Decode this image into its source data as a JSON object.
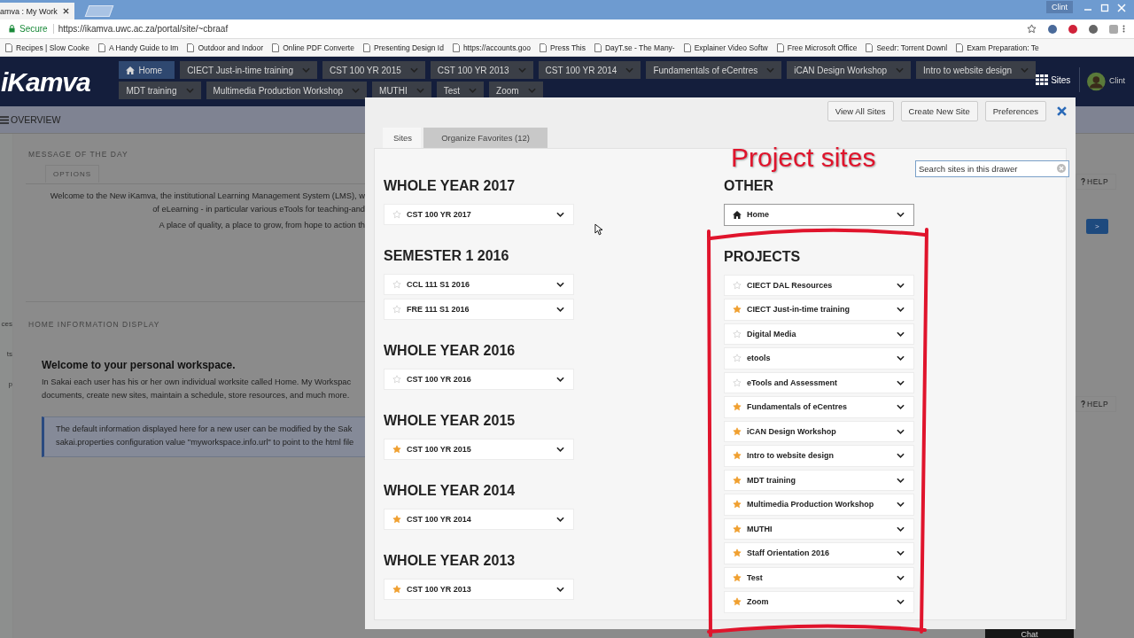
{
  "browser": {
    "tab_title": "amva : My Work",
    "user": "Clint",
    "secure_label": "Secure",
    "url": "https://ikamva.uwc.ac.za/portal/site/~cbraaf",
    "bookmarks": [
      "Recipes | Slow Cooke",
      "A Handy Guide to Im",
      "Outdoor and Indoor",
      "Online PDF Converte",
      "Presenting Design Id",
      "https://accounts.goo",
      "Press This",
      "DayT.se - The Many-",
      "Explainer Video Softw",
      "Free Microsoft Office",
      "Seedr: Torrent Downl",
      "Exam Preparation: Te"
    ]
  },
  "header": {
    "logo": "iKamva",
    "rows": [
      [
        {
          "label": "Home",
          "kind": "home",
          "selected": true
        },
        {
          "label": "CIECT Just-in-time training",
          "kind": "site",
          "selected": false
        },
        {
          "label": "CST 100 YR 2015",
          "kind": "site",
          "selected": false
        },
        {
          "label": "CST 100 YR 2013",
          "kind": "site",
          "selected": false
        },
        {
          "label": "CST 100 YR 2014",
          "kind": "site",
          "selected": false
        },
        {
          "label": "Fundamentals of eCentres",
          "kind": "site",
          "selected": false
        },
        {
          "label": "iCAN Design Workshop",
          "kind": "site",
          "selected": false
        },
        {
          "label": "Intro to website design",
          "kind": "site",
          "selected": false
        }
      ],
      [
        {
          "label": "MDT training",
          "kind": "site",
          "selected": false
        },
        {
          "label": "Multimedia Production Workshop",
          "kind": "site",
          "selected": false
        },
        {
          "label": "MUTHI",
          "kind": "site",
          "selected": false
        },
        {
          "label": "Test",
          "kind": "site",
          "selected": false
        },
        {
          "label": "Zoom",
          "kind": "site",
          "selected": false
        }
      ]
    ],
    "sites_button": "Sites",
    "user": "Clint"
  },
  "page": {
    "overview": "OVERVIEW",
    "side_items": [
      "ces",
      "ts",
      "p"
    ],
    "motd": {
      "title": "MESSAGE OF THE DAY",
      "options": "OPTIONS",
      "lines": [
        "Welcome to the New iKamva, the institutional Learning Management System (LMS), w",
        "of eLearning - in particular various eTools for teaching-and"
      ],
      "tagline": "A place of quality, a place to grow, from hope to action th"
    },
    "home_info": {
      "title": "HOME INFORMATION DISPLAY",
      "heading": "Welcome to your personal workspace.",
      "lines": [
        "In Sakai each user has his or her own individual worksite called Home. My Workspac",
        "documents, create new sites, maintain a schedule, store resources, and much more."
      ],
      "note_lines": [
        "The default information displayed here for a new user can be modified by the Sak",
        "sakai.properties configuration value \"myworkspace.info.url\" to point to the html file"
      ]
    },
    "help_buttons": [
      "HELP",
      "HELP"
    ],
    "go_button": ">"
  },
  "drawer": {
    "actions": [
      "View All Sites",
      "Create New Site",
      "Preferences"
    ],
    "tabs": [
      {
        "label": "Sites",
        "selected": true
      },
      {
        "label": "Organize Favorites (12)",
        "selected": false
      }
    ],
    "search": {
      "placeholder": "Search sites in this drawer"
    },
    "left_groups": [
      {
        "title": "WHOLE YEAR 2017",
        "sites": [
          {
            "name": "CST 100 YR 2017",
            "favorite": false
          }
        ]
      },
      {
        "title": "SEMESTER 1 2016",
        "sites": [
          {
            "name": "CCL 111 S1 2016",
            "favorite": false
          },
          {
            "name": "FRE 111 S1 2016",
            "favorite": false
          }
        ]
      },
      {
        "title": "WHOLE YEAR 2016",
        "sites": [
          {
            "name": "CST 100 YR 2016",
            "favorite": false
          }
        ]
      },
      {
        "title": "WHOLE YEAR 2015",
        "sites": [
          {
            "name": "CST 100 YR 2015",
            "favorite": true
          }
        ]
      },
      {
        "title": "WHOLE YEAR 2014",
        "sites": [
          {
            "name": "CST 100 YR 2014",
            "favorite": true
          }
        ]
      },
      {
        "title": "WHOLE YEAR 2013",
        "sites": [
          {
            "name": "CST 100 YR 2013",
            "favorite": true
          }
        ]
      }
    ],
    "right_groups": [
      {
        "title": "OTHER",
        "sites": [
          {
            "name": "Home",
            "kind": "home"
          }
        ]
      },
      {
        "title": "PROJECTS",
        "sites": [
          {
            "name": "CIECT DAL Resources",
            "favorite": false
          },
          {
            "name": "CIECT Just-in-time training",
            "favorite": true
          },
          {
            "name": "Digital Media",
            "favorite": false
          },
          {
            "name": "etools",
            "favorite": false
          },
          {
            "name": "eTools and Assessment",
            "favorite": false
          },
          {
            "name": "Fundamentals of eCentres",
            "favorite": true
          },
          {
            "name": "iCAN Design Workshop",
            "favorite": true
          },
          {
            "name": "Intro to website design",
            "favorite": true
          },
          {
            "name": "MDT training",
            "favorite": true
          },
          {
            "name": "Multimedia Production Workshop",
            "favorite": true
          },
          {
            "name": "MUTHI",
            "favorite": true
          },
          {
            "name": "Staff Orientation 2016",
            "favorite": true
          },
          {
            "name": "Test",
            "favorite": true
          },
          {
            "name": "Zoom",
            "favorite": true
          }
        ]
      }
    ]
  },
  "annotation": {
    "label": "Project sites"
  },
  "chat": "Chat"
}
